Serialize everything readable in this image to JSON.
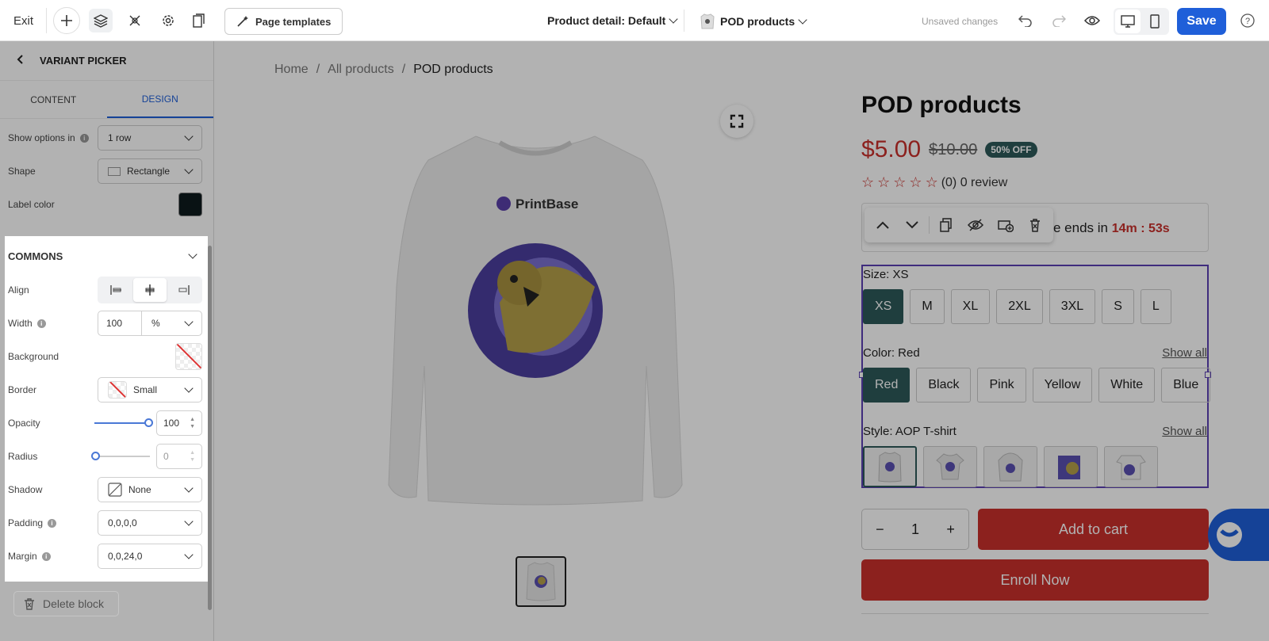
{
  "topbar": {
    "exit_label": "Exit",
    "templates_label": "Page templates",
    "page_dropdown": "Product detail: Default",
    "product_dropdown": "POD products",
    "status": "Unsaved changes",
    "save_label": "Save"
  },
  "sidebar": {
    "header": "VARIANT PICKER",
    "tabs": [
      "CONTENT",
      "DESIGN"
    ],
    "active_tab": "DESIGN",
    "show_options": {
      "label": "Show options in",
      "value": "1 row"
    },
    "shape": {
      "label": "Shape",
      "value": "Rectangle"
    },
    "label_color": {
      "label": "Label color",
      "value": "#0e1a1e"
    },
    "commons": {
      "title": "COMMONS",
      "align_label": "Align",
      "width": {
        "label": "Width",
        "value": "100",
        "unit": "%"
      },
      "background_label": "Background",
      "border": {
        "label": "Border",
        "value": "Small"
      },
      "opacity": {
        "label": "Opacity",
        "value": "100",
        "level": 1.0
      },
      "radius": {
        "label": "Radius",
        "value": "0",
        "level": 0.0
      },
      "shadow": {
        "label": "Shadow",
        "value": "None"
      },
      "padding": {
        "label": "Padding",
        "value": "0,0,0,0"
      },
      "margin": {
        "label": "Margin",
        "value": "0,0,24,0"
      }
    },
    "delete_label": "Delete block"
  },
  "product": {
    "breadcrumb": [
      "Home",
      "All products",
      "POD products"
    ],
    "title": "POD products",
    "price": "$5.00",
    "old_price": "$10.00",
    "badge": "50% OFF",
    "reviews": "(0) 0 review",
    "timer_prefix": "e ends in",
    "timer_value": "14m : 53s",
    "brand": "PrintBase",
    "size_label": "Size: XS",
    "sizes": [
      "XS",
      "M",
      "XL",
      "2XL",
      "3XL",
      "S",
      "L"
    ],
    "color_label": "Color: Red",
    "colors": [
      "Red",
      "Black",
      "Pink",
      "Yellow",
      "White",
      "Blue"
    ],
    "style_label": "Style: AOP T-shirt",
    "show_all": "Show all",
    "qty": "1",
    "qty_minus": "−",
    "qty_plus": "+",
    "add_to_cart": "Add to cart",
    "enroll": "Enroll Now"
  },
  "colors": {
    "accent": "#1f5fd9",
    "price": "#c9302c",
    "swatch_selected": "#2d5a5a",
    "selection": "#5b3fb3"
  }
}
